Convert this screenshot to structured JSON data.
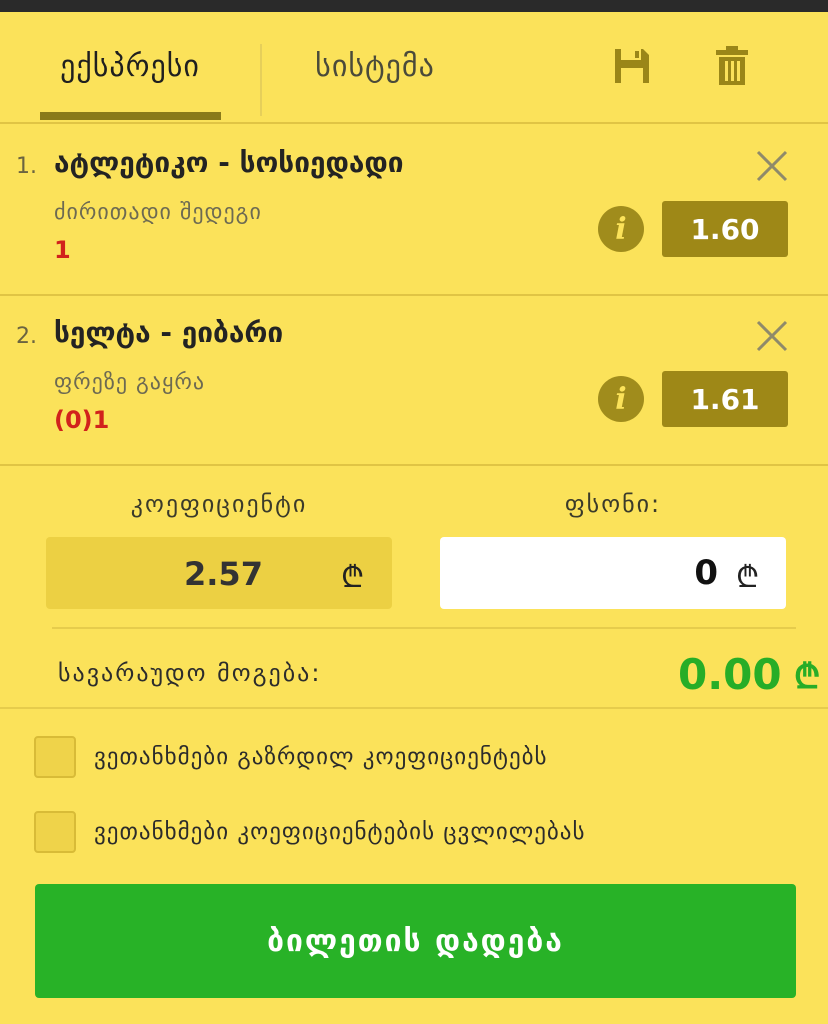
{
  "tabs": {
    "express": "ექსპრესი",
    "system": "სისტემა"
  },
  "toolbar": {
    "save_icon": "save-icon",
    "trash_icon": "trash-icon"
  },
  "bets": [
    {
      "index": "1.",
      "match": "ატლეტიკო - სოსიედადი",
      "market": "ძირითადი შედეგი",
      "outcome": "1",
      "odd": "1.60"
    },
    {
      "index": "2.",
      "match": "სელტა - ეიბარი",
      "market": "ფრეზე გაყრა",
      "outcome": "(0)1",
      "odd": "1.61"
    }
  ],
  "summary": {
    "coef_label": "კოეფიციენტი",
    "stake_label": "ფსონი:",
    "coef_value": "2.57",
    "stake_value": "0",
    "currency": "₾",
    "win_label": "სავარაუდო მოგება:",
    "win_value": "0.00"
  },
  "checks": {
    "increased": "ვეთანხმები გაზრდილ კოეფიციენტებს",
    "changes": "ვეთანხმები კოეფიციენტების ცვლილებას"
  },
  "button": {
    "place_bet": "ბილეთის დადება"
  },
  "colors": {
    "background": "#fbe25a",
    "odd_bg": "#9e8817",
    "accent_green": "#28b227",
    "outcome_red": "#d1221c"
  }
}
